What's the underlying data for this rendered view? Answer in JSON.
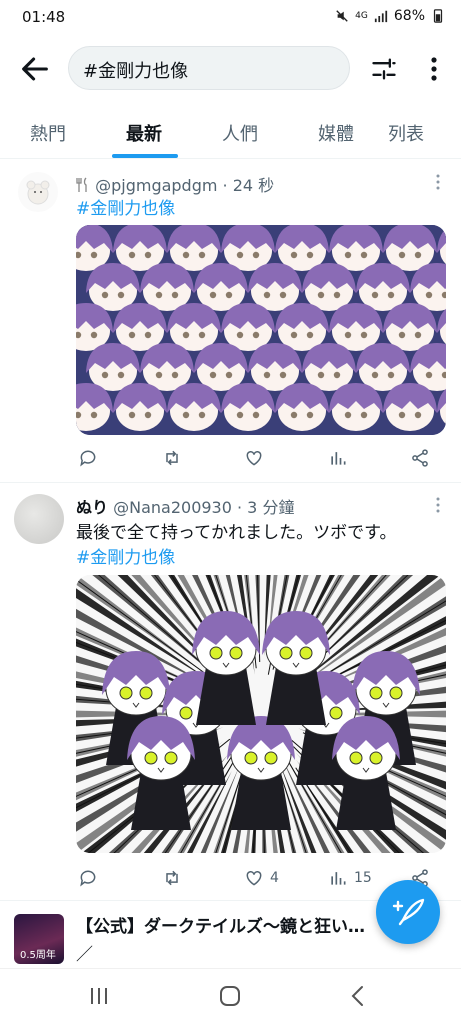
{
  "status_bar": {
    "time": "01:48",
    "battery": "68%",
    "network": "4G"
  },
  "header": {
    "search_query": "#金剛力也像"
  },
  "tabs": [
    {
      "label": "熱門"
    },
    {
      "label": "最新"
    },
    {
      "label": "人們"
    },
    {
      "label": "媒體"
    },
    {
      "label": "列表"
    }
  ],
  "tweets": [
    {
      "author_name": "",
      "handle": "@pjgmgapdgm",
      "time": "· 24 秒",
      "text": "",
      "hashtag": "#金剛力也像",
      "stats": {
        "replies": "",
        "retweets": "",
        "likes": "",
        "views": ""
      }
    },
    {
      "author_name": "ぬり",
      "handle": "@Nana200930",
      "time": "· 3 分鐘",
      "text": "最後で全て持ってかれました。ツボです。",
      "hashtag": "#金剛力也像",
      "stats": {
        "replies": "",
        "retweets": "",
        "likes": "4",
        "views": "15"
      }
    }
  ],
  "promo": {
    "title": "【公式】ダークテイルズ～鏡と狂い…",
    "avatar_badge": "0.5周年"
  },
  "colors": {
    "accent": "#1d9bf0",
    "text": "#0f1419",
    "muted": "#536471",
    "hair": "#8a6bb5"
  }
}
